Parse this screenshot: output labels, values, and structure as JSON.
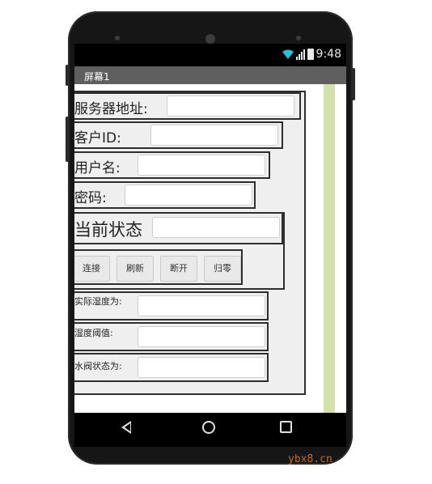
{
  "status_bar": {
    "time": "9:48",
    "wifi_icon": "wifi-icon",
    "signal_icon": "signal-icon",
    "battery_icon": "battery-icon"
  },
  "title_bar": {
    "title": "屏幕1"
  },
  "form": {
    "server_address": {
      "label": "服务器地址:",
      "value": ""
    },
    "client_id": {
      "label": "客户ID:",
      "value": ""
    },
    "username": {
      "label": "用户名:",
      "value": ""
    },
    "password": {
      "label": "密码:",
      "value": ""
    },
    "current_status": {
      "label": "当前状态",
      "value": ""
    }
  },
  "buttons": [
    {
      "label": "连接"
    },
    {
      "label": "刷新"
    },
    {
      "label": "断开"
    },
    {
      "label": "归零"
    }
  ],
  "readings": {
    "actual_humidity": {
      "label": "实际湿度为:",
      "value": ""
    },
    "humidity_threshold": {
      "label": "湿度阈值:",
      "value": ""
    },
    "valve_status": {
      "label": "水阀状态为:",
      "value": ""
    }
  },
  "nav_bar": {
    "back_icon": "back-icon",
    "home_icon": "home-icon",
    "recent_icon": "recent-apps-icon"
  },
  "watermark": "ybx8.cn",
  "colors": {
    "title_bar": "#5f5f5f",
    "side_strip": "#d3e2a9",
    "container": "#efefef"
  }
}
